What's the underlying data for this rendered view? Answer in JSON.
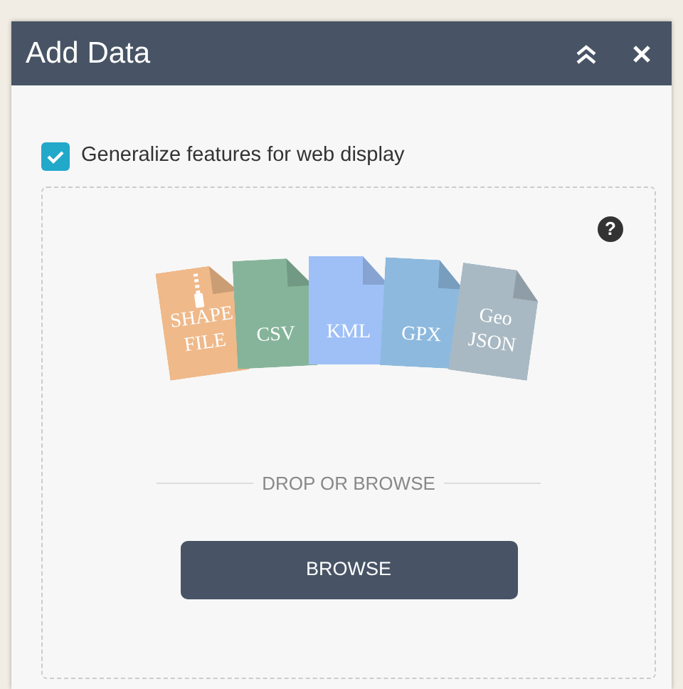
{
  "panel": {
    "title": "Add Data"
  },
  "option": {
    "label": "Generalize features for web display",
    "checked": true
  },
  "help": "?",
  "files": [
    {
      "kind": "zip",
      "lines": [
        "SHAPE",
        "FILE"
      ],
      "color": "#efb98a"
    },
    {
      "kind": "doc",
      "lines": [
        "CSV"
      ],
      "color": "#86b49a"
    },
    {
      "kind": "doc",
      "lines": [
        "KML"
      ],
      "color": "#9fc0f7"
    },
    {
      "kind": "doc",
      "lines": [
        "GPX"
      ],
      "color": "#8db9de"
    },
    {
      "kind": "doc",
      "lines": [
        "Geo",
        "JSON"
      ],
      "color": "#a9b9c3"
    }
  ],
  "divider_text": "DROP OR BROWSE",
  "button": "BROWSE"
}
